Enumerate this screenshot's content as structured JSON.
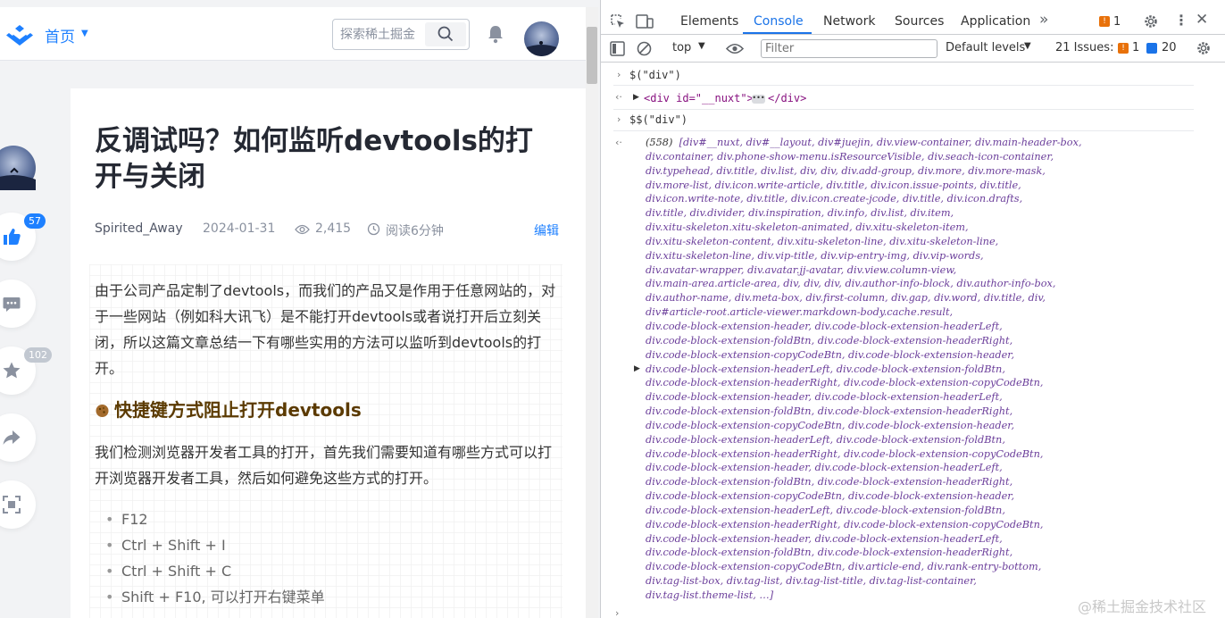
{
  "app": {
    "nav": {
      "home_label": "首页",
      "search_placeholder": "探索稀土掘金"
    },
    "side": {
      "like_count": "57",
      "collect_count": "102"
    },
    "article": {
      "title": "反调试吗？如何监听devtools的打开与关闭",
      "author": "Spirited_Away",
      "date": "2024-01-31",
      "views": "2,415",
      "read_time": "阅读6分钟",
      "edit_label": "编辑",
      "p1": "由于公司产品定制了devtools，而我们的产品又是作用于任意网站的，对于一些网站（例如科大讯飞）是不能打开devtools或者说打开后立刻关闭，所以这篇文章总结一下有哪些实用的方法可以监听到devtools的打开。",
      "h2": "快捷键方式阻止打开devtools",
      "p2": "我们检测浏览器开发者工具的打开，首先我们需要知道有哪些方式可以打开浏览器开发者工具，然后如何避免这些方式的打开。",
      "list": [
        "F12",
        "Ctrl + Shift + I",
        "Ctrl + Shift + C",
        "Shift + F10, 可以打开右键菜单"
      ]
    },
    "devtools": {
      "tabs": [
        "Elements",
        "Console",
        "Network",
        "Sources",
        "Application"
      ],
      "active_tab": "Console",
      "warn_count": "1",
      "context": "top",
      "filter_placeholder": "Filter",
      "levels": "Default levels",
      "issues_label": "21 Issues:",
      "issues_warn": "1",
      "issues_info": "20",
      "cmd1": "$(\"div\")",
      "res1_open": "<div id=\"__nuxt\">",
      "res1_close": "</div>",
      "cmd2": "$$(\"div\")",
      "res2_count": "(558)",
      "res2_lines": [
        "[div#__nuxt, div#__layout, div#juejin, div.view-container, div.main-header-box,",
        "div.container, div.phone-show-menu.isResourceVisible, div.seach-icon-container,",
        "div.typehead, div.title, div.list, div, div, div.add-group, div.more, div.more-mask,",
        "div.more-list, div.icon.write-article, div.title, div.icon.issue-points, div.title,",
        "div.icon.write-note, div.title, div.icon.create-jcode, div.title, div.icon.drafts,",
        "div.title, div.divider, div.inspiration, div.info, div.list, div.item,",
        "div.xitu-skeleton.xitu-skeleton-animated, div.xitu-skeleton-item,",
        "div.xitu-skeleton-content, div.xitu-skeleton-line, div.xitu-skeleton-line,",
        "div.xitu-skeleton-line, div.vip-title, div.vip-entry-img, div.vip-words,",
        "div.avatar-wrapper, div.avatar.jj-avatar, div.view.column-view,",
        "div.main-area.article-area, div, div, div, div.author-info-block, div.author-info-box,",
        "div.author-name, div.meta-box, div.first-column, div.gap, div.word, div.title, div,",
        "div#article-root.article-viewer.markdown-body.cache.result,",
        "div.code-block-extension-header, div.code-block-extension-headerLeft,",
        "div.code-block-extension-foldBtn, div.code-block-extension-headerRight,",
        "div.code-block-extension-copyCodeBtn, div.code-block-extension-header,",
        "div.code-block-extension-headerLeft, div.code-block-extension-foldBtn,",
        "div.code-block-extension-headerRight, div.code-block-extension-copyCodeBtn,",
        "div.code-block-extension-header, div.code-block-extension-headerLeft,",
        "div.code-block-extension-foldBtn, div.code-block-extension-headerRight,",
        "div.code-block-extension-copyCodeBtn, div.code-block-extension-header,",
        "div.code-block-extension-headerLeft, div.code-block-extension-foldBtn,",
        "div.code-block-extension-headerRight, div.code-block-extension-copyCodeBtn,",
        "div.code-block-extension-header, div.code-block-extension-headerLeft,",
        "div.code-block-extension-foldBtn, div.code-block-extension-headerRight,",
        "div.code-block-extension-copyCodeBtn, div.code-block-extension-header,",
        "div.code-block-extension-headerLeft, div.code-block-extension-foldBtn,",
        "div.code-block-extension-headerRight, div.code-block-extension-copyCodeBtn,",
        "div.code-block-extension-header, div.code-block-extension-headerLeft,",
        "div.code-block-extension-foldBtn, div.code-block-extension-headerRight,",
        "div.code-block-extension-copyCodeBtn, div.article-end, div.rank-entry-bottom,",
        "div.tag-list-box, div.tag-list, div.tag-list-title, div.tag-list-container,",
        "div.tag-list.theme-list, …]"
      ]
    },
    "watermark": "@稀土掘金技术社区"
  },
  "colors": {
    "accent": "#1e80ff",
    "devtools_active": "#1a73e8",
    "badge_like": "#1e80ff",
    "badge_collect": "#c2c8d1",
    "heading": "#5b3a00",
    "console_obj": "#6a3d9a"
  },
  "icons": [
    "logo-icon",
    "caret-down-icon",
    "search-icon",
    "bell-icon",
    "avatar",
    "like-icon",
    "comment-icon",
    "star-icon",
    "share-icon",
    "scan-icon",
    "inspect-icon",
    "device-icon",
    "more-tabs-icon",
    "warn-icon",
    "gear-icon",
    "kebab-icon",
    "close-icon",
    "sidebar-toggle-icon",
    "clear-icon",
    "eye-icon",
    "settings-icon",
    "info-icon"
  ]
}
